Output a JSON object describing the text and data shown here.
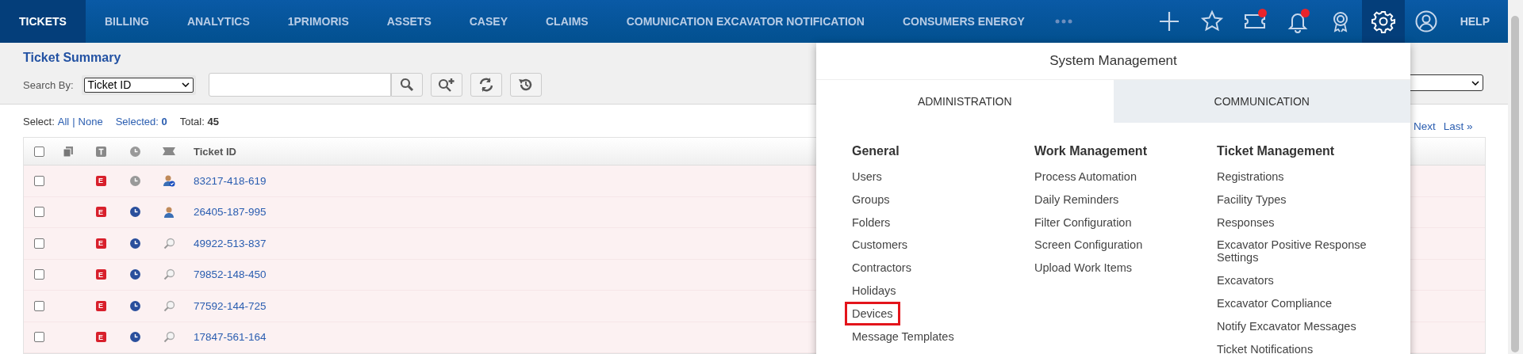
{
  "nav": {
    "tabs": [
      {
        "label": "TICKETS",
        "selected": true
      },
      {
        "label": "BILLING",
        "selected": false
      },
      {
        "label": "ANALYTICS",
        "selected": false
      },
      {
        "label": "1PRIMORIS",
        "selected": false
      },
      {
        "label": "ASSETS",
        "selected": false
      },
      {
        "label": "CASEY",
        "selected": false
      },
      {
        "label": "CLAIMS",
        "selected": false
      },
      {
        "label": "COMUNICATION EXCAVATOR NOTIFICATION",
        "selected": false
      },
      {
        "label": "CONSUMERS ENERGY",
        "selected": false
      }
    ],
    "actions": [
      {
        "kind": "add",
        "badge": false,
        "selected": false
      },
      {
        "kind": "favorite",
        "badge": false,
        "selected": false
      },
      {
        "kind": "ticket",
        "badge": true,
        "selected": false
      },
      {
        "kind": "notifications",
        "badge": true,
        "selected": false
      },
      {
        "kind": "award",
        "badge": false,
        "selected": false
      },
      {
        "kind": "settings",
        "badge": false,
        "selected": true
      },
      {
        "kind": "profile",
        "badge": false,
        "selected": false
      }
    ],
    "help": "HELP"
  },
  "summary": {
    "title": "Ticket Summary",
    "search_by_label": "Search By:",
    "search_by_value": "Ticket ID"
  },
  "selection": {
    "label": "Select:",
    "all": "All",
    "separator": "|",
    "none": "None",
    "selected": "Selected: **0**",
    "total": "Total: **45**"
  },
  "pagination": [
    "Next",
    "Last »"
  ],
  "table": {
    "header_checked": false,
    "column_title": "Ticket ID",
    "rows": [
      {
        "checked": false,
        "type": "E",
        "clock_active": false,
        "kind": "assigned-check",
        "ticket_id": "83217-418-619"
      },
      {
        "checked": false,
        "type": "E",
        "clock_active": true,
        "kind": "assigned",
        "ticket_id": "26405-187-995"
      },
      {
        "checked": false,
        "type": "E",
        "clock_active": true,
        "kind": "search",
        "ticket_id": "49922-513-837"
      },
      {
        "checked": false,
        "type": "E",
        "clock_active": true,
        "kind": "search",
        "ticket_id": "79852-148-450"
      },
      {
        "checked": false,
        "type": "E",
        "clock_active": true,
        "kind": "search",
        "ticket_id": "77592-144-725"
      },
      {
        "checked": false,
        "type": "E",
        "clock_active": true,
        "kind": "search",
        "ticket_id": "17847-561-164"
      }
    ]
  },
  "menu": {
    "title": "System Management",
    "tabs": [
      {
        "label": "ADMINISTRATION",
        "selected": true
      },
      {
        "label": "COMMUNICATION",
        "selected": false
      }
    ],
    "columns": [
      {
        "heading": "General",
        "items": [
          {
            "label": "Users",
            "highlighted": false
          },
          {
            "label": "Groups",
            "highlighted": false
          },
          {
            "label": "Folders",
            "highlighted": false
          },
          {
            "label": "Customers",
            "highlighted": false
          },
          {
            "label": "Contractors",
            "highlighted": false
          },
          {
            "label": "Holidays",
            "highlighted": false
          },
          {
            "label": "Devices",
            "highlighted": true
          },
          {
            "label": "Message Templates",
            "highlighted": false
          }
        ]
      },
      {
        "heading": "Work Management",
        "items": [
          {
            "label": "Process Automation",
            "highlighted": false
          },
          {
            "label": "Daily Reminders",
            "highlighted": false
          },
          {
            "label": "Filter Configuration",
            "highlighted": false
          },
          {
            "label": "Screen Configuration",
            "highlighted": false
          },
          {
            "label": "Upload Work Items",
            "highlighted": false
          }
        ]
      },
      {
        "heading": "Ticket Management",
        "items": [
          {
            "label": "Registrations",
            "highlighted": false
          },
          {
            "label": "Facility Types",
            "highlighted": false
          },
          {
            "label": "Responses",
            "highlighted": false
          },
          {
            "label": "Excavator Positive Response Settings",
            "highlighted": false
          },
          {
            "label": "Excavators",
            "highlighted": false
          },
          {
            "label": "Excavator Compliance",
            "highlighted": false
          },
          {
            "label": "Notify Excavator Messages",
            "highlighted": false
          },
          {
            "label": "Ticket Notifications",
            "highlighted": false
          }
        ]
      }
    ]
  }
}
